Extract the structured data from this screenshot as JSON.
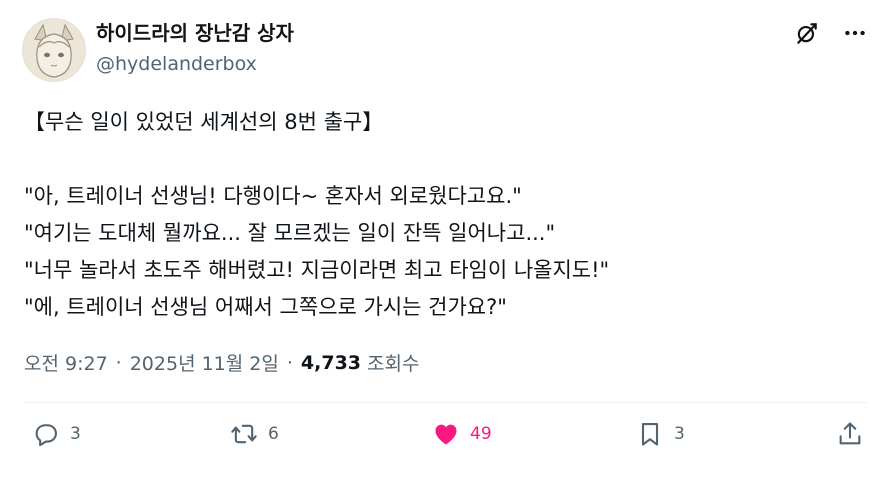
{
  "user": {
    "display_name": "하이드라의 장난감 상자",
    "handle": "@hydelanderbox"
  },
  "tweet": {
    "text": "【무슨 일이 있었던 세계선의 8번 출구】\n\n\"아, 트레이너 선생님! 다행이다~ 혼자서 외로웠다고요.\"\n\"여기는 도대체 뭘까요... 잘 모르겠는 일이 잔뜩 일어나고...\"\n\"너무 놀라서 초도주 해버렸고! 지금이라면 최고 타임이 나올지도!\"\n\"에, 트레이너 선생님 어째서 그쪽으로 가시는 건가요?\""
  },
  "meta": {
    "time": "오전 9:27",
    "separator": "·",
    "date": "2025년 11월 2일",
    "views_count": "4,733",
    "views_label": "조회수"
  },
  "actions": {
    "replies": "3",
    "retweets": "6",
    "likes": "49",
    "bookmarks": "3"
  },
  "colors": {
    "text": "#0f1419",
    "secondary": "#536471",
    "like": "#f91880",
    "divider": "#eff3f4"
  },
  "icons": [
    "grok-icon",
    "more-icon",
    "reply-icon",
    "retweet-icon",
    "heart-icon",
    "bookmark-icon",
    "share-icon"
  ]
}
